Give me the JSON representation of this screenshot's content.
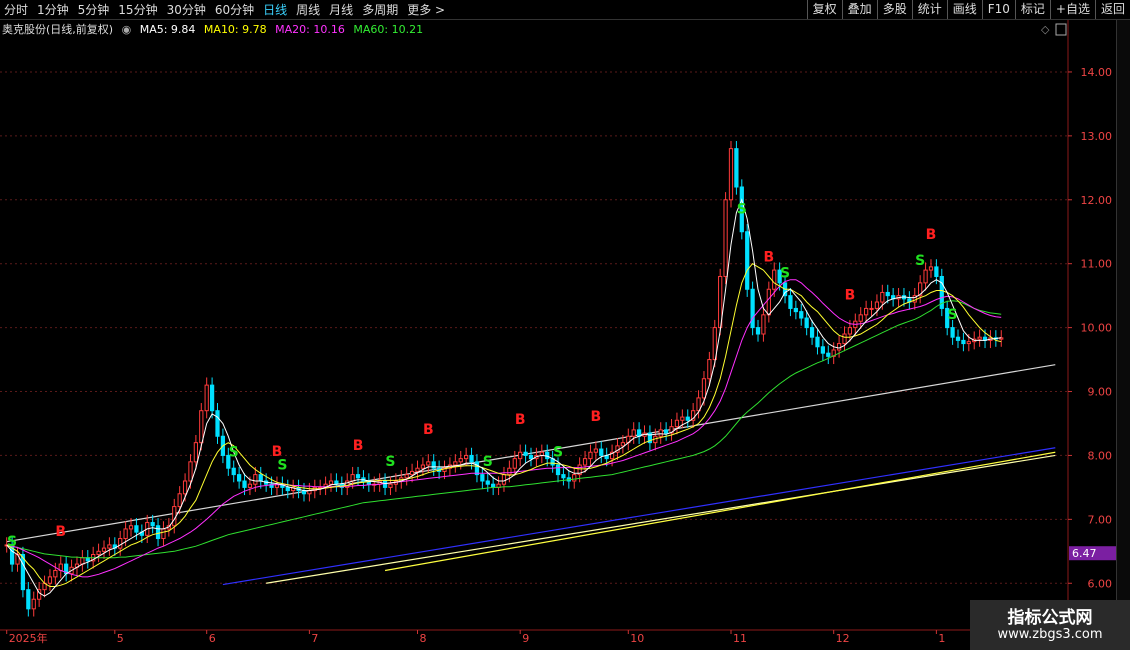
{
  "toolbar": {
    "periods": [
      "分时",
      "1分钟",
      "5分钟",
      "15分钟",
      "30分钟",
      "60分钟",
      "日线",
      "周线",
      "月线",
      "多周期",
      "更多 >"
    ],
    "active_period": "日线",
    "right_buttons": [
      "复权",
      "叠加",
      "多股",
      "统计",
      "画线",
      "F10",
      "标记",
      "+自选",
      "返回"
    ]
  },
  "legend": {
    "stock": "奥克股份(日线,前复权)",
    "ma5": "MA5: 9.84",
    "ma10": "MA10: 9.78",
    "ma20": "MA20: 10.16",
    "ma60": "MA60: 10.21"
  },
  "colors": {
    "up": "#ff3b3b",
    "down": "#00e0ff",
    "ma5": "#ffffff",
    "ma10": "#ffff30",
    "ma20": "#ff30ff",
    "ma60": "#30e030",
    "buy": "#ff2020",
    "sell": "#20e020",
    "current": "#7b1fa2"
  },
  "icons": [
    "diamond-icon",
    "panel-toggle-icon",
    "circle-toggle-icon"
  ],
  "watermark": {
    "line1": "指标公式网",
    "line2": "www.zbgs3.com"
  },
  "chart_data": {
    "type": "candlestick",
    "ylim": [
      5.3,
      14.5
    ],
    "y_ticks": [
      6.0,
      7.0,
      8.0,
      9.0,
      10.0,
      11.0,
      12.0,
      13.0,
      14.0
    ],
    "current_price": "6.47",
    "x_labels": [
      "2025年",
      "5",
      "6",
      "7",
      "8",
      "9",
      "10",
      "11",
      "12",
      "1"
    ],
    "x_label_idx": [
      0,
      20,
      37,
      56,
      76,
      95,
      115,
      134,
      153,
      172
    ],
    "n": 195,
    "closes": [
      6.6,
      6.3,
      6.45,
      5.9,
      5.6,
      5.75,
      5.9,
      6.0,
      6.1,
      6.2,
      6.3,
      6.15,
      6.25,
      6.3,
      6.4,
      6.35,
      6.45,
      6.5,
      6.55,
      6.6,
      6.55,
      6.7,
      6.85,
      6.9,
      6.8,
      6.75,
      6.95,
      6.9,
      6.7,
      6.85,
      6.9,
      7.2,
      7.4,
      7.6,
      7.9,
      8.2,
      8.7,
      9.1,
      8.7,
      8.3,
      8.0,
      7.8,
      7.7,
      7.6,
      7.5,
      7.55,
      7.7,
      7.6,
      7.55,
      7.5,
      7.55,
      7.5,
      7.45,
      7.5,
      7.45,
      7.4,
      7.45,
      7.5,
      7.5,
      7.55,
      7.6,
      7.55,
      7.5,
      7.6,
      7.7,
      7.65,
      7.6,
      7.55,
      7.55,
      7.6,
      7.5,
      7.55,
      7.6,
      7.65,
      7.7,
      7.75,
      7.8,
      7.85,
      7.9,
      7.8,
      7.75,
      7.8,
      7.85,
      7.9,
      7.95,
      8.0,
      7.9,
      7.7,
      7.6,
      7.55,
      7.5,
      7.55,
      7.7,
      7.8,
      7.95,
      8.05,
      8.0,
      7.95,
      8.0,
      8.05,
      7.95,
      7.85,
      7.7,
      7.65,
      7.6,
      7.7,
      7.85,
      7.95,
      8.05,
      8.1,
      8.0,
      7.95,
      8.05,
      8.15,
      8.2,
      8.3,
      8.4,
      8.3,
      8.35,
      8.2,
      8.3,
      8.4,
      8.35,
      8.45,
      8.55,
      8.6,
      8.55,
      8.7,
      8.9,
      9.2,
      9.5,
      10.0,
      10.8,
      12.0,
      12.8,
      12.2,
      11.5,
      10.6,
      10.0,
      9.9,
      10.2,
      10.6,
      10.9,
      10.7,
      10.5,
      10.3,
      10.25,
      10.15,
      10.0,
      9.85,
      9.7,
      9.6,
      9.55,
      9.65,
      9.75,
      9.9,
      10.0,
      10.1,
      10.2,
      10.3,
      10.3,
      10.4,
      10.55,
      10.5,
      10.45,
      10.5,
      10.45,
      10.4,
      10.5,
      10.7,
      10.9,
      10.95,
      10.8,
      10.3,
      10.0,
      9.85,
      9.8,
      9.75,
      9.78,
      9.82,
      9.85,
      9.8,
      9.84,
      9.82,
      9.84
    ],
    "ma5": [
      6.6,
      6.5,
      6.45,
      6.3,
      6.15,
      6.0,
      5.85,
      5.8,
      5.85,
      5.95,
      6.05,
      6.15,
      6.2,
      6.25,
      6.3,
      6.33,
      6.37,
      6.42,
      6.47,
      6.52,
      6.55,
      6.6,
      6.65,
      6.7,
      6.75,
      6.8,
      6.85,
      6.87,
      6.85,
      6.85,
      6.88,
      7.0,
      7.15,
      7.35,
      7.55,
      7.8,
      8.15,
      8.5,
      8.65,
      8.6,
      8.5,
      8.3,
      8.05,
      7.85,
      7.7,
      7.62,
      7.6,
      7.6,
      7.58,
      7.57,
      7.56,
      7.54,
      7.51,
      7.49,
      7.47,
      7.45,
      7.45,
      7.46,
      7.47,
      7.5,
      7.54,
      7.55,
      7.56,
      7.57,
      7.6,
      7.62,
      7.62,
      7.6,
      7.59,
      7.58,
      7.56,
      7.57,
      7.58,
      7.6,
      7.63,
      7.68,
      7.73,
      7.78,
      7.82,
      7.82,
      7.82,
      7.82,
      7.83,
      7.84,
      7.85,
      7.88,
      7.88,
      7.85,
      7.8,
      7.73,
      7.65,
      7.6,
      7.6,
      7.64,
      7.7,
      7.8,
      7.88,
      7.93,
      7.98,
      8.0,
      7.99,
      7.95,
      7.9,
      7.83,
      7.76,
      7.72,
      7.72,
      7.75,
      7.83,
      7.92,
      7.98,
      8.0,
      8.03,
      8.08,
      8.13,
      8.2,
      8.27,
      8.3,
      8.33,
      8.32,
      8.33,
      8.34,
      8.33,
      8.36,
      8.42,
      8.48,
      8.52,
      8.58,
      8.68,
      8.85,
      9.1,
      9.45,
      9.95,
      10.6,
      11.3,
      11.8,
      12.0,
      11.7,
      11.2,
      10.6,
      10.3,
      10.2,
      10.3,
      10.4,
      10.55,
      10.6,
      10.5,
      10.4,
      10.25,
      10.1,
      9.98,
      9.85,
      9.75,
      9.7,
      9.68,
      9.72,
      9.8,
      9.9,
      10.0,
      10.1,
      10.17,
      10.25,
      10.35,
      10.42,
      10.45,
      10.47,
      10.48,
      10.47,
      10.47,
      10.52,
      10.6,
      10.7,
      10.75,
      10.7,
      10.55,
      10.35,
      10.15,
      9.95,
      9.85,
      9.8,
      9.8,
      9.8,
      9.82,
      9.83,
      9.84
    ],
    "ma10": [
      6.6,
      6.55,
      6.5,
      6.4,
      6.3,
      6.22,
      6.1,
      6.0,
      5.95,
      5.95,
      5.97,
      6.0,
      6.05,
      6.1,
      6.15,
      6.2,
      6.25,
      6.3,
      6.35,
      6.4,
      6.45,
      6.5,
      6.55,
      6.6,
      6.63,
      6.67,
      6.72,
      6.76,
      6.78,
      6.8,
      6.82,
      6.88,
      6.95,
      7.05,
      7.18,
      7.3,
      7.5,
      7.7,
      7.9,
      8.05,
      8.15,
      8.2,
      8.15,
      8.05,
      7.95,
      7.85,
      7.78,
      7.72,
      7.67,
      7.62,
      7.58,
      7.56,
      7.54,
      7.52,
      7.5,
      7.49,
      7.48,
      7.48,
      7.48,
      7.49,
      7.5,
      7.51,
      7.52,
      7.53,
      7.55,
      7.57,
      7.58,
      7.59,
      7.6,
      7.61,
      7.61,
      7.61,
      7.61,
      7.62,
      7.63,
      7.65,
      7.67,
      7.7,
      7.73,
      7.75,
      7.77,
      7.79,
      7.81,
      7.82,
      7.83,
      7.84,
      7.84,
      7.83,
      7.81,
      7.78,
      7.75,
      7.72,
      7.7,
      7.69,
      7.7,
      7.72,
      7.75,
      7.78,
      7.82,
      7.85,
      7.88,
      7.88,
      7.87,
      7.85,
      7.83,
      7.8,
      7.79,
      7.79,
      7.8,
      7.82,
      7.85,
      7.88,
      7.92,
      7.96,
      8.0,
      8.05,
      8.1,
      8.15,
      8.2,
      8.23,
      8.26,
      8.28,
      8.3,
      8.32,
      8.35,
      8.38,
      8.41,
      8.45,
      8.5,
      8.6,
      8.75,
      8.95,
      9.2,
      9.55,
      9.95,
      10.35,
      10.7,
      10.9,
      11.0,
      10.95,
      10.9,
      10.8,
      10.7,
      10.65,
      10.6,
      10.6,
      10.55,
      10.5,
      10.4,
      10.32,
      10.25,
      10.15,
      10.05,
      9.95,
      9.88,
      9.85,
      9.85,
      9.87,
      9.9,
      9.95,
      10.0,
      10.05,
      10.12,
      10.2,
      10.26,
      10.32,
      10.37,
      10.4,
      10.43,
      10.47,
      10.5,
      10.55,
      10.58,
      10.58,
      10.55,
      10.5,
      10.42,
      10.32,
      10.2,
      10.1,
      10.0,
      9.92,
      9.86,
      9.8,
      9.78
    ],
    "ma20": [
      6.6,
      6.58,
      6.56,
      6.52,
      6.48,
      6.44,
      6.4,
      6.35,
      6.3,
      6.25,
      6.2,
      6.17,
      6.14,
      6.12,
      6.1,
      6.1,
      6.12,
      6.14,
      6.17,
      6.2,
      6.23,
      6.27,
      6.31,
      6.35,
      6.39,
      6.43,
      6.47,
      6.51,
      6.55,
      6.58,
      6.62,
      6.66,
      6.7,
      6.75,
      6.8,
      6.86,
      6.93,
      7.0,
      7.08,
      7.16,
      7.24,
      7.3,
      7.36,
      7.4,
      7.44,
      7.47,
      7.5,
      7.52,
      7.53,
      7.54,
      7.54,
      7.54,
      7.54,
      7.53,
      7.53,
      7.52,
      7.52,
      7.51,
      7.51,
      7.51,
      7.51,
      7.51,
      7.51,
      7.52,
      7.52,
      7.53,
      7.53,
      7.54,
      7.54,
      7.55,
      7.56,
      7.57,
      7.58,
      7.59,
      7.6,
      7.61,
      7.62,
      7.63,
      7.64,
      7.65,
      7.66,
      7.67,
      7.68,
      7.69,
      7.7,
      7.71,
      7.72,
      7.72,
      7.72,
      7.72,
      7.72,
      7.72,
      7.73,
      7.73,
      7.74,
      7.75,
      7.76,
      7.77,
      7.78,
      7.79,
      7.8,
      7.8,
      7.81,
      7.81,
      7.81,
      7.81,
      7.81,
      7.82,
      7.83,
      7.84,
      7.85,
      7.86,
      7.88,
      7.9,
      7.92,
      7.95,
      7.98,
      8.01,
      8.04,
      8.07,
      8.1,
      8.13,
      8.16,
      8.19,
      8.22,
      8.26,
      8.3,
      8.34,
      8.4,
      8.48,
      8.58,
      8.7,
      8.85,
      9.05,
      9.3,
      9.55,
      9.8,
      10.0,
      10.15,
      10.25,
      10.35,
      10.45,
      10.55,
      10.65,
      10.72,
      10.75,
      10.75,
      10.7,
      10.62,
      10.55,
      10.47,
      10.38,
      10.3,
      10.22,
      10.15,
      10.1,
      10.06,
      10.05,
      10.06,
      10.08,
      10.11,
      10.14,
      10.17,
      10.2,
      10.22,
      10.25,
      10.27,
      10.29,
      10.31,
      10.33,
      10.36,
      10.4,
      10.44,
      10.47,
      10.49,
      10.48,
      10.45,
      10.4,
      10.35,
      10.3,
      10.26,
      10.22,
      10.19,
      10.17,
      10.16
    ],
    "ma60": [
      6.6,
      6.58,
      6.56,
      6.54,
      6.52,
      6.5,
      6.48,
      6.46,
      6.45,
      6.44,
      6.43,
      6.42,
      6.41,
      6.41,
      6.4,
      6.4,
      6.4,
      6.4,
      6.4,
      6.4,
      6.4,
      6.41,
      6.41,
      6.42,
      6.43,
      6.44,
      6.45,
      6.46,
      6.47,
      6.48,
      6.49,
      6.5,
      6.52,
      6.54,
      6.56,
      6.58,
      6.61,
      6.64,
      6.67,
      6.7,
      6.73,
      6.76,
      6.78,
      6.8,
      6.82,
      6.84,
      6.86,
      6.88,
      6.9,
      6.92,
      6.94,
      6.96,
      6.98,
      7.0,
      7.02,
      7.04,
      7.06,
      7.08,
      7.1,
      7.12,
      7.14,
      7.16,
      7.18,
      7.2,
      7.22,
      7.24,
      7.26,
      7.27,
      7.28,
      7.29,
      7.3,
      7.31,
      7.32,
      7.33,
      7.34,
      7.35,
      7.36,
      7.37,
      7.38,
      7.39,
      7.4,
      7.41,
      7.42,
      7.43,
      7.44,
      7.45,
      7.46,
      7.47,
      7.48,
      7.49,
      7.5,
      7.5,
      7.51,
      7.51,
      7.52,
      7.53,
      7.54,
      7.55,
      7.56,
      7.57,
      7.58,
      7.59,
      7.6,
      7.61,
      7.62,
      7.63,
      7.64,
      7.65,
      7.66,
      7.67,
      7.68,
      7.69,
      7.7,
      7.72,
      7.74,
      7.76,
      7.78,
      7.8,
      7.82,
      7.84,
      7.86,
      7.88,
      7.9,
      7.92,
      7.94,
      7.96,
      7.98,
      8.0,
      8.03,
      8.06,
      8.1,
      8.15,
      8.22,
      8.3,
      8.4,
      8.5,
      8.6,
      8.68,
      8.75,
      8.82,
      8.9,
      8.98,
      9.05,
      9.12,
      9.18,
      9.24,
      9.29,
      9.33,
      9.37,
      9.41,
      9.45,
      9.48,
      9.52,
      9.56,
      9.6,
      9.64,
      9.68,
      9.72,
      9.76,
      9.8,
      9.84,
      9.88,
      9.92,
      9.96,
      10.0,
      10.04,
      10.07,
      10.1,
      10.13,
      10.17,
      10.22,
      10.27,
      10.33,
      10.38,
      10.41,
      10.42,
      10.41,
      10.38,
      10.34,
      10.3,
      10.27,
      10.25,
      10.23,
      10.22,
      10.21
    ],
    "lines": [
      {
        "color": "#d8d8d8",
        "x": [
          0,
          194
        ],
        "y": [
          6.65,
          9.42
        ]
      },
      {
        "color": "#3030ff",
        "x": [
          40,
          194
        ],
        "y": [
          5.98,
          8.12
        ]
      },
      {
        "color": "#ffffaa",
        "x": [
          48,
          194
        ],
        "y": [
          6.0,
          8.0
        ]
      },
      {
        "color": "#ffff40",
        "x": [
          70,
          194
        ],
        "y": [
          6.2,
          8.05
        ]
      }
    ],
    "signals": [
      {
        "type": "S",
        "i": 1
      },
      {
        "type": "B",
        "i": 10
      },
      {
        "type": "S",
        "i": 42
      },
      {
        "type": "B",
        "i": 50
      },
      {
        "type": "S",
        "i": 51
      },
      {
        "type": "B",
        "i": 65
      },
      {
        "type": "S",
        "i": 71
      },
      {
        "type": "B",
        "i": 78
      },
      {
        "type": "S",
        "i": 89
      },
      {
        "type": "B",
        "i": 95
      },
      {
        "type": "S",
        "i": 102
      },
      {
        "type": "B",
        "i": 109
      },
      {
        "type": "S",
        "i": 136
      },
      {
        "type": "B",
        "i": 141
      },
      {
        "type": "S",
        "i": 144
      },
      {
        "type": "B",
        "i": 156
      },
      {
        "type": "S",
        "i": 169
      },
      {
        "type": "B",
        "i": 171
      },
      {
        "type": "S",
        "i": 175
      }
    ]
  }
}
